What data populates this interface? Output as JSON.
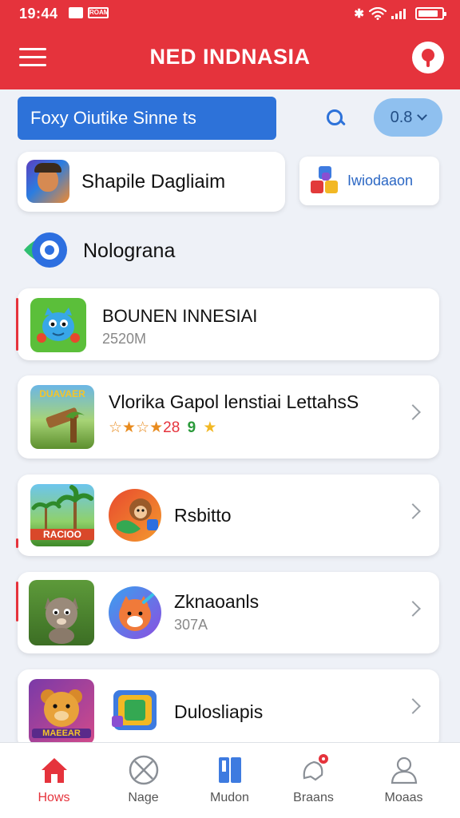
{
  "status_bar": {
    "time": "19:44",
    "sim_label": "ROAM",
    "bluetooth": "✱"
  },
  "header": {
    "title": "NED INDNASIA"
  },
  "search": {
    "value": "Foxy Oiutike Sinne ts",
    "filter_label": "0.8"
  },
  "featured": {
    "main_label": "Shapile Dagliaim",
    "side_label": "Iwiodaaon"
  },
  "section": {
    "label": "Nolograna"
  },
  "apps": [
    {
      "title": "BOUNEN INNESIAI",
      "sub": "2520M"
    },
    {
      "title": "Vlorika Gapol lenstiai LettahsS",
      "rating_text": "28",
      "rating_prefix": "☆★☆★",
      "rating_num": "9",
      "tile_text": "DUAVAER"
    },
    {
      "title": "Rsbitto",
      "tile_text": "RACIOO"
    },
    {
      "title": "Zknaoanls",
      "sub": "307A"
    },
    {
      "title": "Dulosliapis",
      "tile_text": "MAEEAR"
    }
  ],
  "nav": [
    {
      "label": "Hows"
    },
    {
      "label": "Nage"
    },
    {
      "label": "Mudon"
    },
    {
      "label": "Braans"
    },
    {
      "label": "Moaas"
    }
  ],
  "colors": {
    "brand_red": "#e5333c",
    "search_blue": "#2d72d9",
    "pill_blue": "#8fc0ef"
  }
}
